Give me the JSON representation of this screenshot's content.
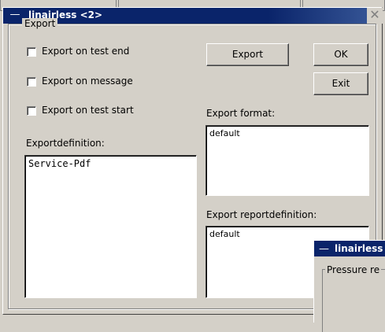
{
  "window": {
    "title": "linairless <2>",
    "menu_glyph": "—",
    "close_glyph": "✕"
  },
  "export_group": {
    "label": "Export",
    "checkboxes": [
      {
        "label": "Export on test end",
        "checked": false
      },
      {
        "label": "Export on message",
        "checked": false
      },
      {
        "label": "Export on test start",
        "checked": false
      }
    ],
    "buttons": {
      "export": "Export",
      "ok": "OK",
      "exit": "Exit"
    },
    "exportdefinition": {
      "label": "Exportdefinition:",
      "items": [
        "Service-Pdf"
      ]
    },
    "export_format": {
      "label": "Export format:",
      "value": "default"
    },
    "export_reportdefinition": {
      "label": "Export reportdefinition:",
      "value": "default"
    }
  },
  "sub_window": {
    "title": "linairless",
    "menu_glyph": "—",
    "group_label": "Pressure re"
  }
}
